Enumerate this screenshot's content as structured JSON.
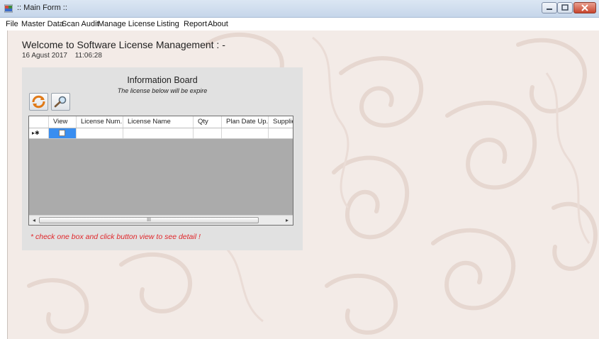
{
  "window": {
    "title": ":: Main Form ::",
    "icon": "app-icon",
    "controls": [
      "minimize-icon",
      "maximize-icon",
      "close-icon"
    ]
  },
  "menu": [
    {
      "label": "File"
    },
    {
      "label": "Master Data"
    },
    {
      "label": "Scan Audit"
    },
    {
      "label": "Manage License"
    },
    {
      "label": "Listing"
    },
    {
      "label": "Report"
    },
    {
      "label": "About"
    }
  ],
  "welcome": {
    "text": "Welcome to Software License Management :  -",
    "date": "16 Agust 2017",
    "time": "11:06:28"
  },
  "board": {
    "title": "Information Board",
    "subtitle": "The license below will be expire",
    "buttons": [
      {
        "icon": "refresh-icon"
      },
      {
        "icon": "search-icon"
      }
    ],
    "grid": {
      "columns": [
        "",
        "View",
        "License Num...",
        "License Name",
        "Qty",
        "Plan Date Up...",
        "Supplie"
      ],
      "rows": [
        {
          "indicator": "▸✱",
          "view_checked": false,
          "license_num": "",
          "license_name": "",
          "qty": "",
          "plan_date": "",
          "supplier": ""
        }
      ],
      "scroll_label": "III"
    },
    "hint": "* check one box and click button view to see detail !"
  },
  "colors": {
    "hint": "#e0262a",
    "selection": "#3a8ef0",
    "panel": "#e1e1e1",
    "background": "#f3ebe7"
  }
}
